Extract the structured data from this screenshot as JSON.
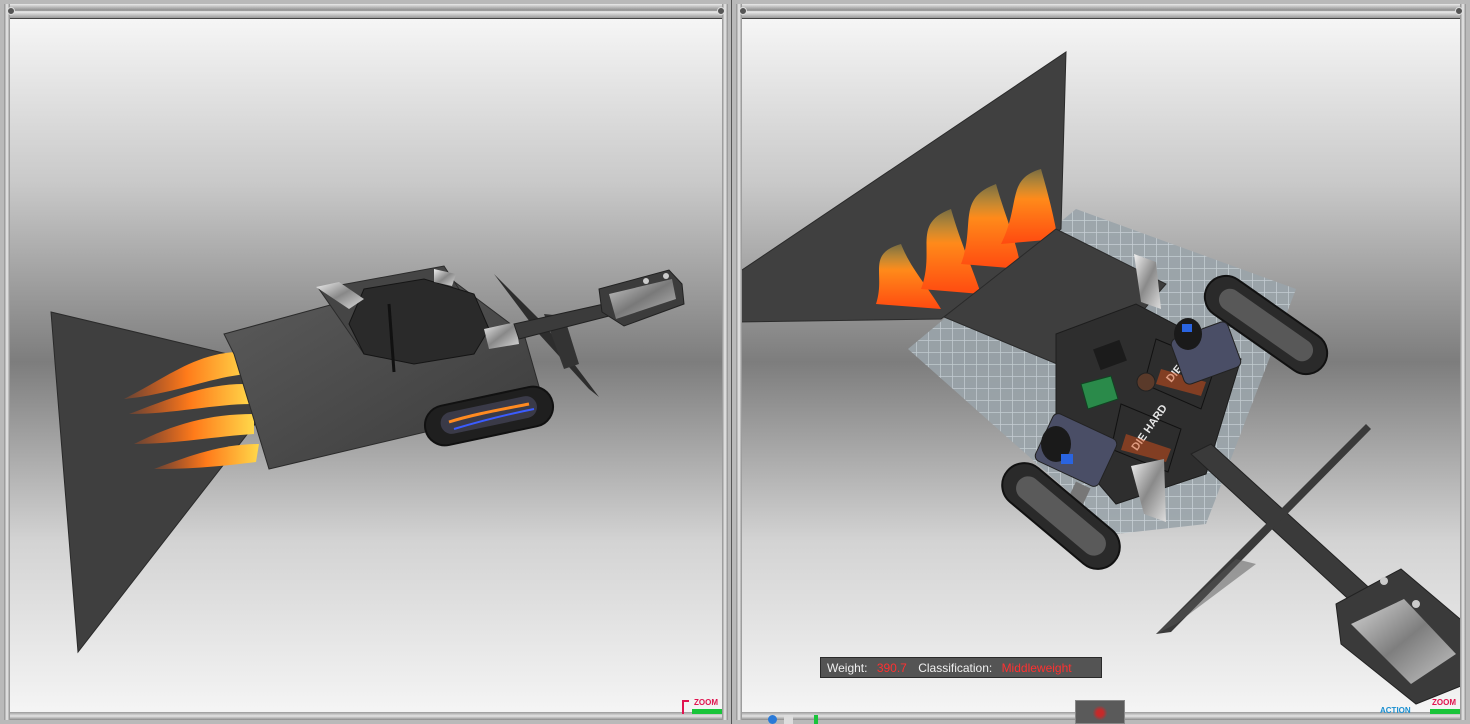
{
  "left_view": {
    "name": "front-view",
    "zoom_label": "ZOOM"
  },
  "right_view": {
    "name": "top-view",
    "zoom_label": "ZOOM",
    "action_label": "ACTION"
  },
  "stats": {
    "weight_label": "Weight:",
    "weight_value": "390.7",
    "class_label": "Classification:",
    "class_value": "Middleweight"
  },
  "robot": {
    "battery_label": "DIE HARD"
  },
  "colors": {
    "accent_red": "#ff3030",
    "zoom_red": "#e0134f",
    "zoom_green": "#19c43a",
    "action_blue": "#1a8fd0"
  }
}
